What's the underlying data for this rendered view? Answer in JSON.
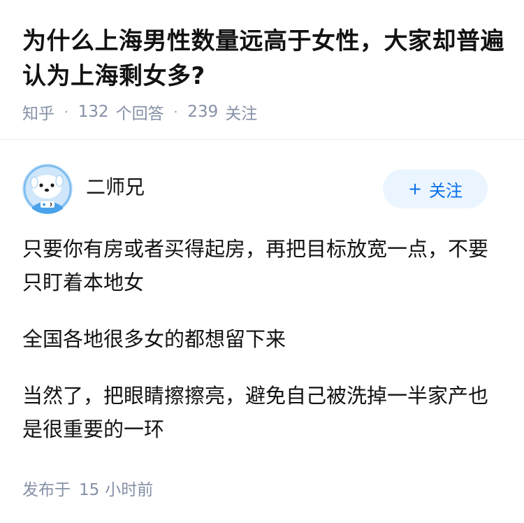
{
  "question": {
    "title": "为什么上海男性数量远高于女性，大家却普遍认为上海剩女多?",
    "source": "知乎",
    "answer_count": "132",
    "answer_label": "个回答",
    "follower_count": "239",
    "follower_label": "关注"
  },
  "answer": {
    "author": {
      "name": "二师兄",
      "avatar_icon": "cartoon-dog-avatar-icon"
    },
    "follow_button": {
      "icon": "plus-icon",
      "label": "关注"
    },
    "paragraphs": [
      "只要你有房或者买得起房，再把目标放宽一点，不要只盯着本地女",
      "全国各地很多女的都想留下来",
      "当然了，把眼睛擦擦亮，避免自己被洗掉一半家产也是很重要的一环"
    ],
    "time": {
      "prefix": "发布于",
      "value": "15",
      "suffix": "小时前"
    }
  },
  "colors": {
    "accent": "#056de8",
    "accent_bg": "#ebf5ff",
    "meta_text": "#8590a6",
    "main_text": "#121212",
    "avatar_bg": "#cfe6fb",
    "avatar_ring": "#7fbdf0"
  }
}
